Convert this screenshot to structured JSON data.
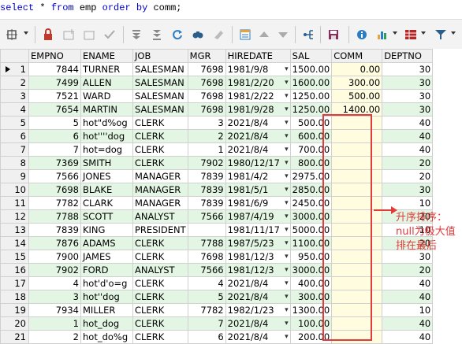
{
  "sql": {
    "kw_select": "select",
    "star": " * ",
    "kw_from": "from",
    "table": " emp ",
    "kw_order": "order by",
    "col": " comm;"
  },
  "grid": {
    "columns": [
      "EMPNO",
      "ENAME",
      "JOB",
      "MGR",
      "HIREDATE",
      "SAL",
      "COMM",
      "DEPTNO"
    ],
    "rows": [
      {
        "n": "1",
        "empno": "7844",
        "ename": "TURNER",
        "job": "SALESMAN",
        "mgr": "7698",
        "hiredate": "1981/9/8",
        "sal": "1500.00",
        "comm": "0.00",
        "deptno": "30"
      },
      {
        "n": "2",
        "empno": "7499",
        "ename": "ALLEN",
        "job": "SALESMAN",
        "mgr": "7698",
        "hiredate": "1981/2/20",
        "sal": "1600.00",
        "comm": "300.00",
        "deptno": "30"
      },
      {
        "n": "3",
        "empno": "7521",
        "ename": "WARD",
        "job": "SALESMAN",
        "mgr": "7698",
        "hiredate": "1981/2/22",
        "sal": "1250.00",
        "comm": "500.00",
        "deptno": "30"
      },
      {
        "n": "4",
        "empno": "7654",
        "ename": "MARTIN",
        "job": "SALESMAN",
        "mgr": "7698",
        "hiredate": "1981/9/28",
        "sal": "1250.00",
        "comm": "1400.00",
        "deptno": "30"
      },
      {
        "n": "5",
        "empno": "5",
        "ename": "hot\"d%og",
        "job": "CLERK",
        "mgr": "3",
        "hiredate": "2021/8/4",
        "sal": "500.00",
        "comm": "",
        "deptno": "40"
      },
      {
        "n": "6",
        "empno": "6",
        "ename": "hot''''dog",
        "job": "CLERK",
        "mgr": "2",
        "hiredate": "2021/8/4",
        "sal": "600.00",
        "comm": "",
        "deptno": "40"
      },
      {
        "n": "7",
        "empno": "7",
        "ename": "hot=dog",
        "job": "CLERK",
        "mgr": "1",
        "hiredate": "2021/8/4",
        "sal": "700.00",
        "comm": "",
        "deptno": "40"
      },
      {
        "n": "8",
        "empno": "7369",
        "ename": "SMITH",
        "job": "CLERK",
        "mgr": "7902",
        "hiredate": "1980/12/17",
        "sal": "800.00",
        "comm": "",
        "deptno": "20"
      },
      {
        "n": "9",
        "empno": "7566",
        "ename": "JONES",
        "job": "MANAGER",
        "mgr": "7839",
        "hiredate": "1981/4/2",
        "sal": "2975.00",
        "comm": "",
        "deptno": "20"
      },
      {
        "n": "10",
        "empno": "7698",
        "ename": "BLAKE",
        "job": "MANAGER",
        "mgr": "7839",
        "hiredate": "1981/5/1",
        "sal": "2850.00",
        "comm": "",
        "deptno": "30"
      },
      {
        "n": "11",
        "empno": "7782",
        "ename": "CLARK",
        "job": "MANAGER",
        "mgr": "7839",
        "hiredate": "1981/6/9",
        "sal": "2450.00",
        "comm": "",
        "deptno": "10"
      },
      {
        "n": "12",
        "empno": "7788",
        "ename": "SCOTT",
        "job": "ANALYST",
        "mgr": "7566",
        "hiredate": "1987/4/19",
        "sal": "3000.00",
        "comm": "",
        "deptno": "20"
      },
      {
        "n": "13",
        "empno": "7839",
        "ename": "KING",
        "job": "PRESIDENT",
        "mgr": "",
        "hiredate": "1981/11/17",
        "sal": "5000.00",
        "comm": "",
        "deptno": "10"
      },
      {
        "n": "14",
        "empno": "7876",
        "ename": "ADAMS",
        "job": "CLERK",
        "mgr": "7788",
        "hiredate": "1987/5/23",
        "sal": "1100.00",
        "comm": "",
        "deptno": "20"
      },
      {
        "n": "15",
        "empno": "7900",
        "ename": "JAMES",
        "job": "CLERK",
        "mgr": "7698",
        "hiredate": "1981/12/3",
        "sal": "950.00",
        "comm": "",
        "deptno": "30"
      },
      {
        "n": "16",
        "empno": "7902",
        "ename": "FORD",
        "job": "ANALYST",
        "mgr": "7566",
        "hiredate": "1981/12/3",
        "sal": "3000.00",
        "comm": "",
        "deptno": "20"
      },
      {
        "n": "17",
        "empno": "4",
        "ename": "hot'd'o=g",
        "job": "CLERK",
        "mgr": "4",
        "hiredate": "2021/8/4",
        "sal": "400.00",
        "comm": "",
        "deptno": "40"
      },
      {
        "n": "18",
        "empno": "3",
        "ename": "hot''dog",
        "job": "CLERK",
        "mgr": "5",
        "hiredate": "2021/8/4",
        "sal": "300.00",
        "comm": "",
        "deptno": "40"
      },
      {
        "n": "19",
        "empno": "7934",
        "ename": "MILLER",
        "job": "CLERK",
        "mgr": "7782",
        "hiredate": "1982/1/23",
        "sal": "1300.00",
        "comm": "",
        "deptno": "10"
      },
      {
        "n": "20",
        "empno": "1",
        "ename": "hot_dog",
        "job": "CLERK",
        "mgr": "7",
        "hiredate": "2021/8/4",
        "sal": "100.00",
        "comm": "",
        "deptno": "40"
      },
      {
        "n": "21",
        "empno": "2",
        "ename": "hot_do%g",
        "job": "CLERK",
        "mgr": "6",
        "hiredate": "2021/8/4",
        "sal": "200.00",
        "comm": "",
        "deptno": "40"
      }
    ]
  },
  "annotation": {
    "text": "升序排序：\nnull为极大值\n排在最后"
  },
  "icons": {
    "toolbar": [
      "grid-options-icon",
      "lock-icon",
      "add-record-icon",
      "delete-record-icon",
      "post-edit-icon",
      "first-record-icon",
      "last-record-icon",
      "refresh-icon",
      "find-icon",
      "clear-icon",
      "single-record-view-icon",
      "sort-up-icon",
      "sort-down-icon",
      "query-by-example-icon",
      "save-icon",
      "info-icon",
      "chart-icon",
      "export-icon",
      "filter-icon"
    ]
  },
  "colors": {
    "even_row": "#e3f6e3",
    "highlight_box": "#e23b3b",
    "sql_keyword": "#0000c8"
  }
}
